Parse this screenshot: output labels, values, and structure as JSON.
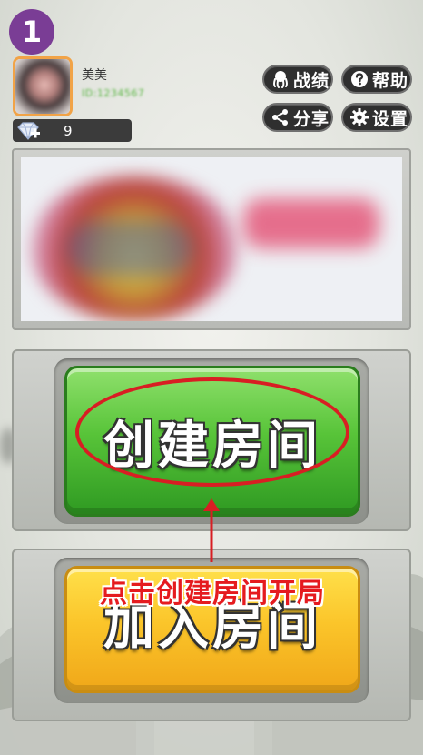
{
  "step_number": "1",
  "profile": {
    "username": "美美",
    "subtext": "ID:1234567",
    "diamond_count": "9"
  },
  "top_buttons": {
    "record_label": "战绩",
    "help_label": "帮助",
    "share_label": "分享",
    "settings_label": "设置"
  },
  "main_buttons": {
    "create_room_label": "创建房间",
    "join_room_label": "加入房间"
  },
  "annotation": {
    "caption": "点击创建房间开局",
    "color": "#e51b1f"
  },
  "icons": {
    "record": "octopus-icon",
    "help": "question-circle-icon",
    "share": "share-icon",
    "settings": "gear-icon",
    "diamond": "diamond-plus-icon"
  },
  "colors": {
    "create_button": "#58c439",
    "join_button": "#fbc52a",
    "step_badge": "#7a3d95",
    "avatar_border": "#f1a347"
  }
}
